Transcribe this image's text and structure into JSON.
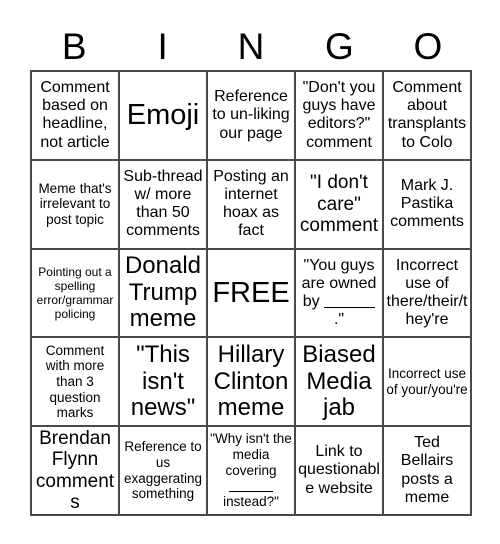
{
  "card": {
    "title": "BINGO",
    "header_letters": [
      "B",
      "I",
      "N",
      "G",
      "O"
    ],
    "columns": 5,
    "rows": 5,
    "free_space": {
      "row": 3,
      "column": 3,
      "label": "FREE"
    },
    "grid": [
      [
        {
          "text": "Comment based on headline, not article",
          "size": "md",
          "marked": false
        },
        {
          "text": "Emoji",
          "size": "xxl",
          "marked": false
        },
        {
          "text": "Reference to un-liking our page",
          "size": "md",
          "marked": false
        },
        {
          "text": "\"Don't you guys have editors?\" comment",
          "size": "md",
          "marked": false
        },
        {
          "text": "Comment about transplants to Colo",
          "size": "md",
          "marked": false
        }
      ],
      [
        {
          "text": "Meme that's irrelevant to post topic",
          "size": "sm",
          "marked": false
        },
        {
          "text": "Sub-thread w/ more than 50 comments",
          "size": "md",
          "marked": false
        },
        {
          "text": "Posting an internet hoax as fact",
          "size": "md",
          "marked": false
        },
        {
          "text": "\"I don't care\" comment",
          "size": "lg",
          "marked": false
        },
        {
          "text": "Mark J. Pastika comments",
          "size": "md",
          "marked": false
        }
      ],
      [
        {
          "text": "Pointing out a spelling error/grammar policing",
          "size": "xs",
          "marked": false
        },
        {
          "text": "Donald Trump meme",
          "size": "xl",
          "marked": false
        },
        {
          "text": "FREE",
          "size": "xxl",
          "marked": false,
          "is_free": true
        },
        {
          "text": "\"You guys are owned by ___.\"",
          "size": "md",
          "marked": false,
          "has_blank": "middle"
        },
        {
          "text": "Incorrect use of there/their/they're",
          "size": "md",
          "marked": false
        }
      ],
      [
        {
          "text": "Comment with more than 3 question marks",
          "size": "sm",
          "marked": false
        },
        {
          "text": "\"This isn't news\"",
          "size": "xl",
          "marked": false
        },
        {
          "text": "Hillary Clinton meme",
          "size": "xl",
          "marked": false
        },
        {
          "text": "Biased Media jab",
          "size": "xl",
          "marked": false
        },
        {
          "text": "Incorrect use of your/you're",
          "size": "sm",
          "marked": false
        }
      ],
      [
        {
          "text": "Brendan Flynn comments",
          "size": "lg",
          "marked": false
        },
        {
          "text": "Reference to us exaggerating something",
          "size": "sm",
          "marked": false
        },
        {
          "text": "\"Why isn't the media covering ___ instead?\"",
          "size": "sm",
          "marked": false,
          "has_blank": "end"
        },
        {
          "text": "Link to questionable website",
          "size": "md",
          "marked": false
        },
        {
          "text": "Ted Bellairs posts a meme",
          "size": "md",
          "marked": false
        }
      ]
    ]
  },
  "colors": {
    "background": "#ffffff",
    "text": "#000000",
    "grid_line": "#4a4a4a"
  }
}
